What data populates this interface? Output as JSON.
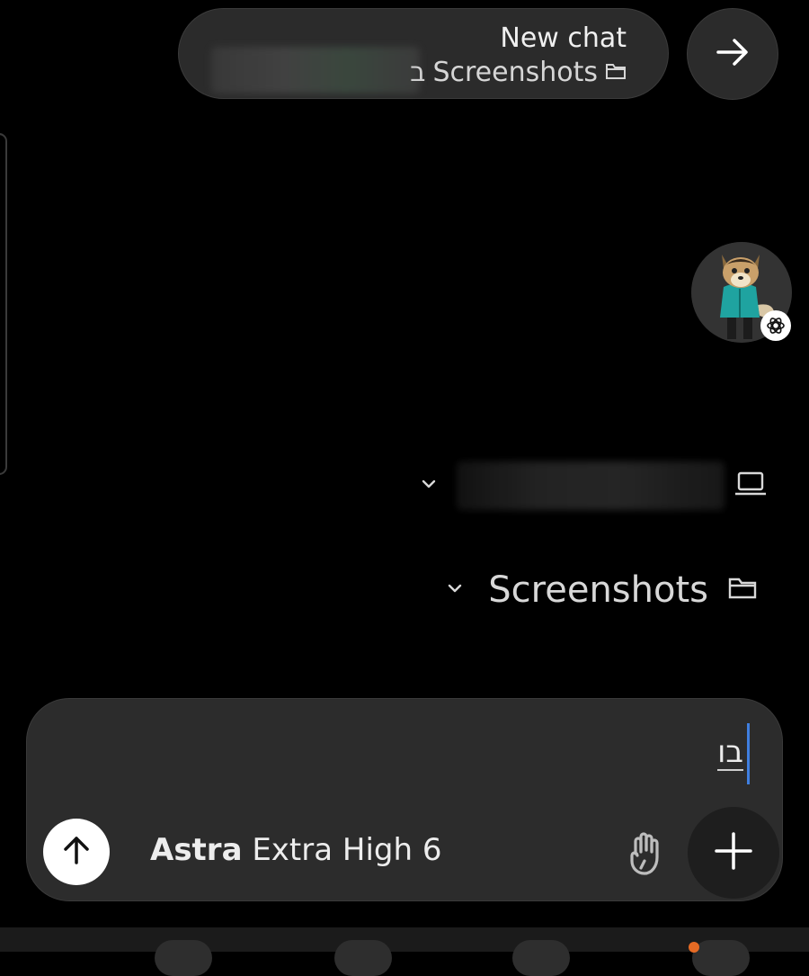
{
  "header": {
    "title": "New chat",
    "subtitle_lead": "ב",
    "subtitle": "Screenshots",
    "folder_icon": "folder-icon"
  },
  "forward_button": {
    "icon": "arrow-right-icon"
  },
  "avatar": {
    "icon": "wolf-avatar",
    "badge_icon": "openai-logo-icon"
  },
  "context": {
    "device": {
      "icon": "laptop-icon",
      "chevron": "chevron-down-icon"
    },
    "folder": {
      "label": "Screenshots",
      "icon": "folder-icon",
      "chevron": "chevron-down-icon"
    }
  },
  "composer": {
    "input_value": "בו",
    "send_icon": "arrow-up-icon",
    "model_name": "Astra",
    "model_variant": "Extra High 6",
    "stop_icon": "hand-stop-icon",
    "add_icon": "plus-icon"
  },
  "colors": {
    "background": "#000000",
    "surface": "#2c2c2c",
    "cursor": "#3f7fe0",
    "notification_dot": "#e56a24"
  }
}
